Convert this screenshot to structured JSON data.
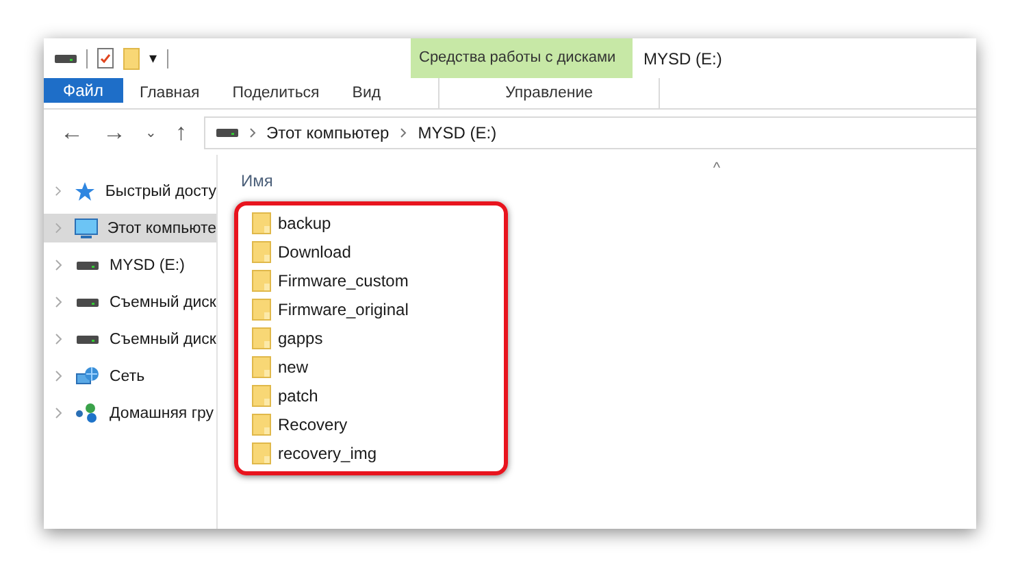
{
  "quick_toolbar": {
    "menu_glyph": "▾"
  },
  "context_tab": {
    "group": "Средства работы с дисками",
    "label": "Управление"
  },
  "window": {
    "title": "MYSD (E:)"
  },
  "ribbon_tabs": [
    {
      "label": "Файл",
      "kind": "file"
    },
    {
      "label": "Главная",
      "kind": "tab"
    },
    {
      "label": "Поделиться",
      "kind": "tab"
    },
    {
      "label": "Вид",
      "kind": "tab"
    }
  ],
  "address": {
    "nav": [
      "←",
      "→",
      "⌄",
      "↑"
    ],
    "crumbs": [
      "Этот компьютер",
      "MYSD (E:)"
    ]
  },
  "sidebar": {
    "items": [
      {
        "label": "Быстрый досту",
        "kind": "star",
        "selected": false
      },
      {
        "label": "Этот компьюте",
        "kind": "computer",
        "selected": true
      },
      {
        "label": "MYSD (E:)",
        "kind": "drive",
        "selected": false
      },
      {
        "label": "Съемный диск",
        "kind": "drive",
        "selected": false
      },
      {
        "label": "Съемный диск",
        "kind": "drive",
        "selected": false
      },
      {
        "label": "Сеть",
        "kind": "network",
        "selected": false
      },
      {
        "label": "Домашняя гру",
        "kind": "homegroup",
        "selected": false
      }
    ]
  },
  "file_list": {
    "column": "Имя",
    "sort_glyph": "^",
    "highlighted": true,
    "items": [
      {
        "name": "backup"
      },
      {
        "name": "Download"
      },
      {
        "name": "Firmware_custom"
      },
      {
        "name": "Firmware_original"
      },
      {
        "name": "gapps"
      },
      {
        "name": "new"
      },
      {
        "name": "patch"
      },
      {
        "name": "Recovery"
      },
      {
        "name": "recovery_img"
      }
    ]
  }
}
